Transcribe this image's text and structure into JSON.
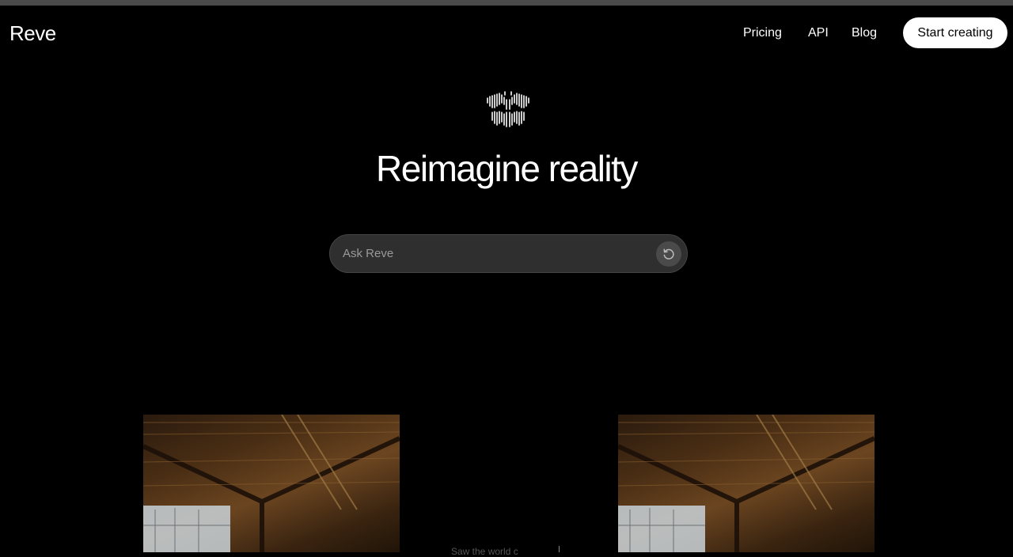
{
  "brand": {
    "logo": "Reve"
  },
  "nav": {
    "pricing": "Pricing",
    "api": "API",
    "blog": "Blog",
    "cta": "Start creating"
  },
  "hero": {
    "title": "Reimagine reality",
    "icon": "butterfly-icon"
  },
  "search": {
    "placeholder": "Ask Reve",
    "button_icon": "refresh-icon"
  },
  "gallery": {
    "caption": "Saw the world c"
  },
  "colors": {
    "background": "#000000",
    "input_bg": "#2f2f2f",
    "cta_bg": "#ffffff",
    "cta_text": "#000000"
  }
}
